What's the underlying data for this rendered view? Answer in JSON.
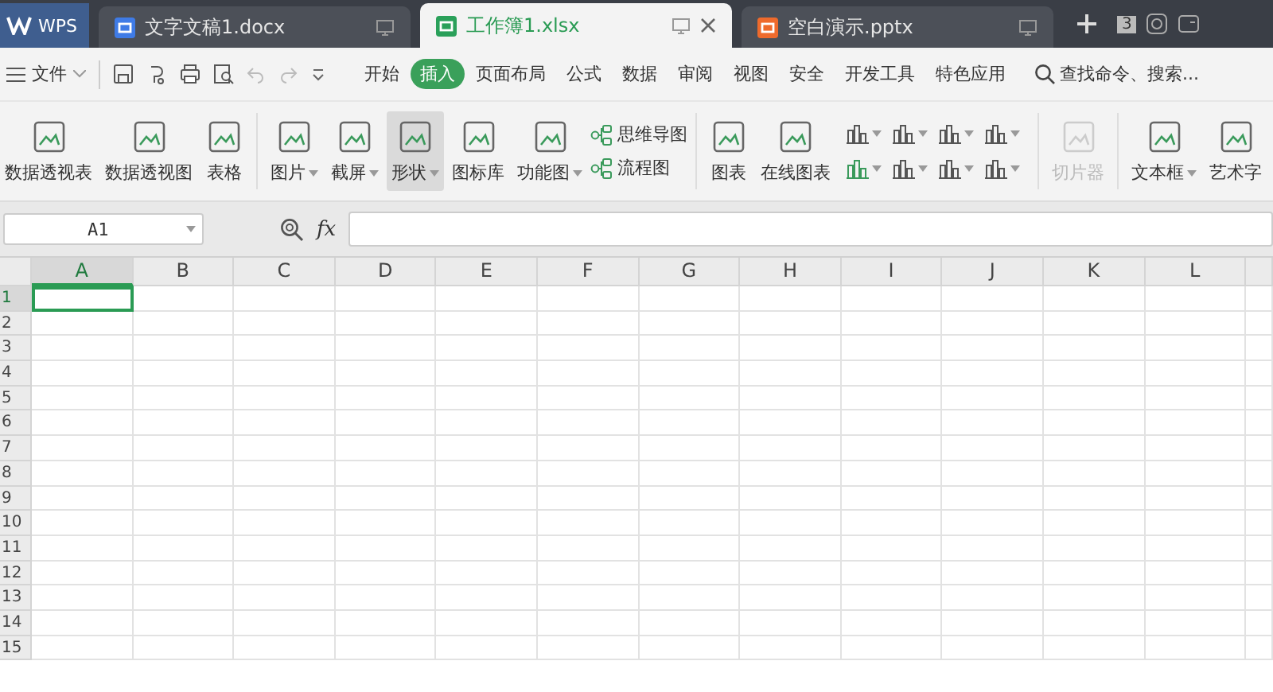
{
  "app_tab": {
    "label": "WPS"
  },
  "doc_tabs": [
    {
      "label": "文字文稿1.docx",
      "kind": "writer",
      "selected": false
    },
    {
      "label": "工作簿1.xlsx",
      "kind": "sheet",
      "selected": true
    },
    {
      "label": "空白演示.pptx",
      "kind": "slides",
      "selected": false
    }
  ],
  "window_count": "3",
  "menu": {
    "file": "文件",
    "tabs": [
      {
        "label": "开始",
        "selected": false
      },
      {
        "label": "插入",
        "selected": true
      },
      {
        "label": "页面布局",
        "selected": false
      },
      {
        "label": "公式",
        "selected": false
      },
      {
        "label": "数据",
        "selected": false
      },
      {
        "label": "审阅",
        "selected": false
      },
      {
        "label": "视图",
        "selected": false
      },
      {
        "label": "安全",
        "selected": false
      },
      {
        "label": "开发工具",
        "selected": false
      },
      {
        "label": "特色应用",
        "selected": false
      }
    ],
    "search": "查找命令、搜索..."
  },
  "ribbon": [
    {
      "items": [
        {
          "kind": "large",
          "label": "数据透视表",
          "dropdown": false,
          "highlighted": false,
          "disabled": false
        },
        {
          "kind": "large",
          "label": "数据透视图",
          "dropdown": false,
          "highlighted": false,
          "disabled": false
        },
        {
          "kind": "large",
          "label": "表格",
          "dropdown": false,
          "highlighted": false,
          "disabled": false
        }
      ]
    },
    {
      "items": [
        {
          "kind": "large",
          "label": "图片",
          "dropdown": true,
          "highlighted": false,
          "disabled": false
        },
        {
          "kind": "large",
          "label": "截屏",
          "dropdown": true,
          "highlighted": false,
          "disabled": false
        },
        {
          "kind": "large",
          "label": "形状",
          "dropdown": true,
          "highlighted": true,
          "disabled": false
        },
        {
          "kind": "large",
          "label": "图标库",
          "dropdown": false,
          "highlighted": false,
          "disabled": false
        },
        {
          "kind": "large",
          "label": "功能图",
          "dropdown": true,
          "highlighted": false,
          "disabled": false
        },
        {
          "kind": "small",
          "label": "思维导图"
        },
        {
          "kind": "small",
          "label": "流程图"
        }
      ]
    },
    {
      "items": [
        {
          "kind": "large",
          "label": "图表",
          "dropdown": false,
          "highlighted": false,
          "disabled": false
        },
        {
          "kind": "large",
          "label": "在线图表",
          "dropdown": false,
          "highlighted": false,
          "disabled": false
        },
        {
          "kind": "chart-grid"
        }
      ]
    },
    {
      "items": [
        {
          "kind": "large",
          "label": "切片器",
          "dropdown": false,
          "highlighted": false,
          "disabled": true
        }
      ]
    },
    {
      "items": [
        {
          "kind": "large",
          "label": "文本框",
          "dropdown": true,
          "highlighted": false,
          "disabled": false
        },
        {
          "kind": "large",
          "label": "艺术字",
          "dropdown": false,
          "highlighted": false,
          "disabled": false
        }
      ]
    }
  ],
  "name_box": "A1",
  "formula_label": "fx",
  "columns": [
    {
      "label": "A",
      "selected": true
    },
    {
      "label": "B",
      "selected": false
    },
    {
      "label": "C",
      "selected": false
    },
    {
      "label": "D",
      "selected": false
    },
    {
      "label": "E",
      "selected": false
    },
    {
      "label": "F",
      "selected": false
    },
    {
      "label": "G",
      "selected": false
    },
    {
      "label": "H",
      "selected": false
    },
    {
      "label": "I",
      "selected": false
    },
    {
      "label": "J",
      "selected": false
    },
    {
      "label": "K",
      "selected": false
    },
    {
      "label": "L",
      "selected": false
    }
  ],
  "rows": [
    {
      "label": "1",
      "selected": true
    },
    {
      "label": "2",
      "selected": false
    },
    {
      "label": "3",
      "selected": false
    },
    {
      "label": "4",
      "selected": false
    },
    {
      "label": "5",
      "selected": false
    },
    {
      "label": "6",
      "selected": false
    },
    {
      "label": "7",
      "selected": false
    },
    {
      "label": "8",
      "selected": false
    },
    {
      "label": "9",
      "selected": false
    },
    {
      "label": "10",
      "selected": false
    },
    {
      "label": "11",
      "selected": false
    },
    {
      "label": "12",
      "selected": false
    },
    {
      "label": "13",
      "selected": false
    },
    {
      "label": "14",
      "selected": false
    },
    {
      "label": "15",
      "selected": false
    }
  ]
}
